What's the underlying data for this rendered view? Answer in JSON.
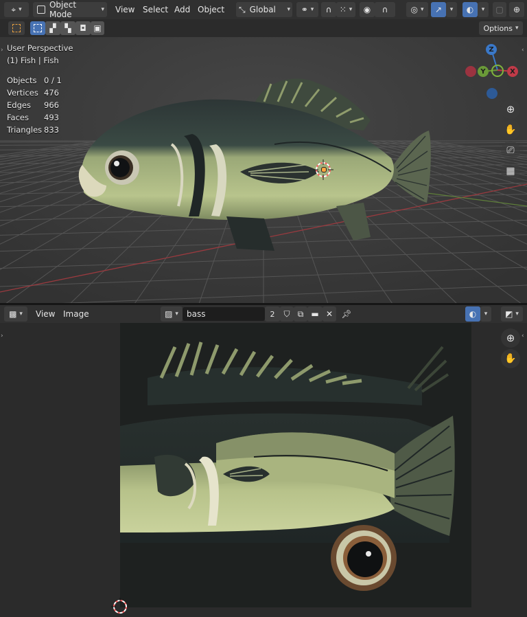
{
  "viewport3d": {
    "header": {
      "mode_label": "Object Mode",
      "menus": [
        "View",
        "Select",
        "Add",
        "Object"
      ],
      "orientation_label": "Global",
      "options_label": "Options"
    },
    "overlay": {
      "perspective": "User Perspective",
      "collection_object": "(1) Fish | Fish",
      "stats": [
        {
          "label": "Objects",
          "value": "0 / 1"
        },
        {
          "label": "Vertices",
          "value": "476"
        },
        {
          "label": "Edges",
          "value": "966"
        },
        {
          "label": "Faces",
          "value": "493"
        },
        {
          "label": "Triangles",
          "value": "833"
        }
      ]
    },
    "gizmo": {
      "z": "Z",
      "y": "Y",
      "x": "X"
    },
    "nav_icons": [
      "zoom-icon",
      "hand-pan-icon",
      "camera-icon",
      "grid-perspective-icon"
    ]
  },
  "image_editor": {
    "header": {
      "menus": [
        "View",
        "Image"
      ],
      "image_name": "bass",
      "users_count": "2"
    },
    "nav_icons": [
      "zoom-icon",
      "hand-pan-icon"
    ]
  },
  "colors": {
    "accent": "#4772b3",
    "header_bg": "#303030",
    "viewport_bg": "#3d3d3d",
    "fish_light": "#b9c58e",
    "fish_dark": "#283232"
  }
}
